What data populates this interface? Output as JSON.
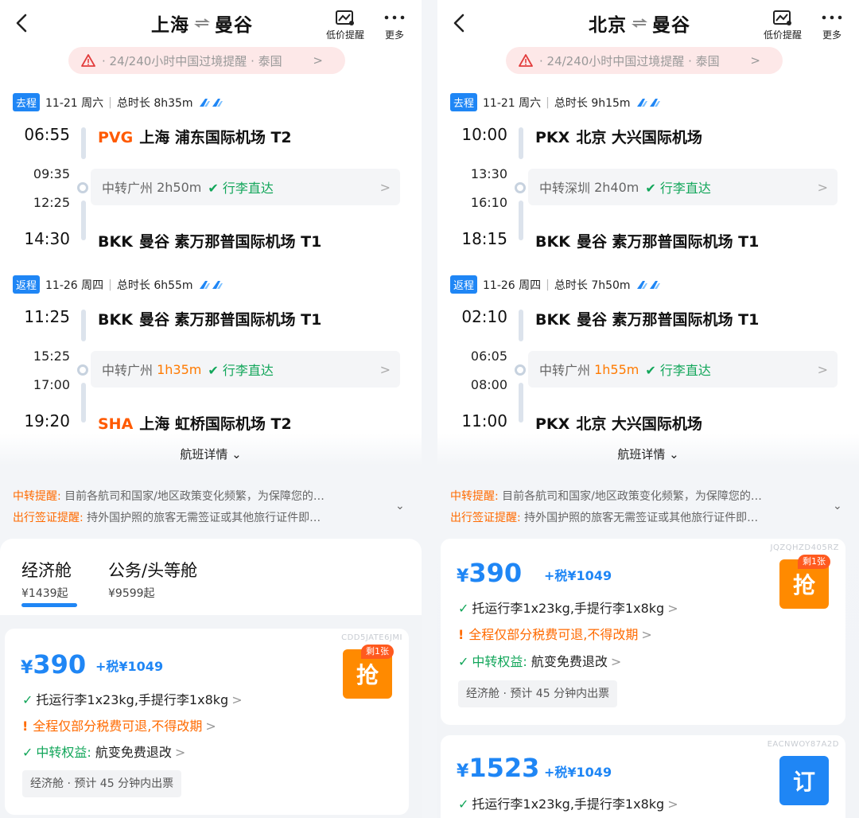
{
  "panels": [
    {
      "title_from": "上海",
      "title_to": "曼谷",
      "header_buttons": {
        "price_alert": "低价提醒",
        "more": "更多"
      },
      "notice": "·  24/240小时中国过境提醒  · 泰国",
      "outbound": {
        "tag": "去程",
        "date": "11-21 周六",
        "total": "总时长 8h35m",
        "dep_time": "06:55",
        "dep_code": "PVG",
        "dep_airport": "上海 浦东国际机场 T2",
        "arr_transfer": "09:35",
        "dep_transfer": "12:25",
        "transfer_city": "中转广州",
        "transfer_dur": "2h50m",
        "baggage": "✔ 行李直达",
        "arr_time": "14:30",
        "arr_code": "BKK",
        "arr_airport": "曼谷 素万那普国际机场 T1"
      },
      "inbound": {
        "tag": "返程",
        "date": "11-26 周四",
        "total": "总时长 6h55m",
        "dep_time": "11:25",
        "dep_code": "BKK",
        "dep_airport": "曼谷 素万那普国际机场 T1",
        "arr_transfer": "15:25",
        "dep_transfer": "17:00",
        "transfer_city": "中转广州",
        "transfer_dur": "1h35m",
        "baggage": "✔ 行李直达",
        "arr_time": "19:20",
        "arr_code": "SHA",
        "arr_airport": "上海 虹桥国际机场 T2"
      },
      "detail_link": "航班详情",
      "reminders": [
        {
          "key": "中转提醒:",
          "text": "目前各航司和国家/地区政策变化频繁，为保障您的…"
        },
        {
          "key": "出行签证提醒:",
          "text": "持外国护照的旅客无需签证或其他旅行证件即…"
        }
      ],
      "cabins": [
        {
          "name": "经济舱",
          "price": "¥1439起"
        },
        {
          "name": "公务/头等舱",
          "price": "¥9599起"
        }
      ],
      "fares": [
        {
          "code": "CDD5JATE6JMI",
          "currency": "¥",
          "amount": "390",
          "tax": "+税¥1049",
          "baggage": "托运行李1x23kg,手提行李1x8kg",
          "refund": "全程仅部分税费可退,不得改期",
          "benefit_key": "中转权益:",
          "benefit": "航变免费退改",
          "ticketing": "经济舱 · 预计 45 分钟内出票",
          "action": "抢",
          "badge": "剩1张"
        }
      ]
    },
    {
      "title_from": "北京",
      "title_to": "曼谷",
      "header_buttons": {
        "price_alert": "低价提醒",
        "more": "更多"
      },
      "notice": "·  24/240小时中国过境提醒  · 泰国",
      "outbound": {
        "tag": "去程",
        "date": "11-21 周六",
        "total": "总时长 9h15m",
        "dep_time": "10:00",
        "dep_code": "PKX",
        "dep_airport": "北京 大兴国际机场",
        "arr_transfer": "13:30",
        "dep_transfer": "16:10",
        "transfer_city": "中转深圳",
        "transfer_dur": "2h40m",
        "baggage": "✔ 行李直达",
        "arr_time": "18:15",
        "arr_code": "BKK",
        "arr_airport": "曼谷 素万那普国际机场 T1"
      },
      "inbound": {
        "tag": "返程",
        "date": "11-26 周四",
        "total": "总时长 7h50m",
        "dep_time": "02:10",
        "dep_code": "BKK",
        "dep_airport": "曼谷 素万那普国际机场 T1",
        "arr_transfer": "06:05",
        "dep_transfer": "08:00",
        "transfer_city": "中转广州",
        "transfer_dur": "1h55m",
        "baggage": "✔ 行李直达",
        "arr_time": "11:00",
        "arr_code": "PKX",
        "arr_airport": "北京 大兴国际机场"
      },
      "detail_link": "航班详情",
      "reminders": [
        {
          "key": "中转提醒:",
          "text": "目前各航司和国家/地区政策变化频繁，为保障您的…"
        },
        {
          "key": "出行签证提醒:",
          "text": "持外国护照的旅客无需签证或其他旅行证件即…"
        }
      ],
      "fares": [
        {
          "code": "JQZQHZD405RZ",
          "currency": "¥",
          "amount": "390",
          "tax": "+税¥1049",
          "baggage": "托运行李1x23kg,手提行李1x8kg",
          "refund": "全程仅部分税费可退,不得改期",
          "benefit_key": "中转权益:",
          "benefit": "航变免费退改",
          "ticketing": "经济舱 · 预计 45 分钟内出票",
          "action": "抢",
          "badge": "剩1张"
        },
        {
          "code": "EACNWOY87A2D",
          "currency": "¥",
          "amount": "1523",
          "tax": "+税¥1049",
          "baggage": "托运行李1x23kg,手提行李1x8kg",
          "action": "订"
        }
      ]
    }
  ],
  "colors": {
    "accent": "#1f86f5",
    "orange": "#ff6a00",
    "green": "#12a65a"
  },
  "icons": {
    "back": "chevron-left-icon",
    "price_alert": "chart-bell-icon",
    "more": "more-dots-icon",
    "warning": "warning-triangle-icon"
  }
}
